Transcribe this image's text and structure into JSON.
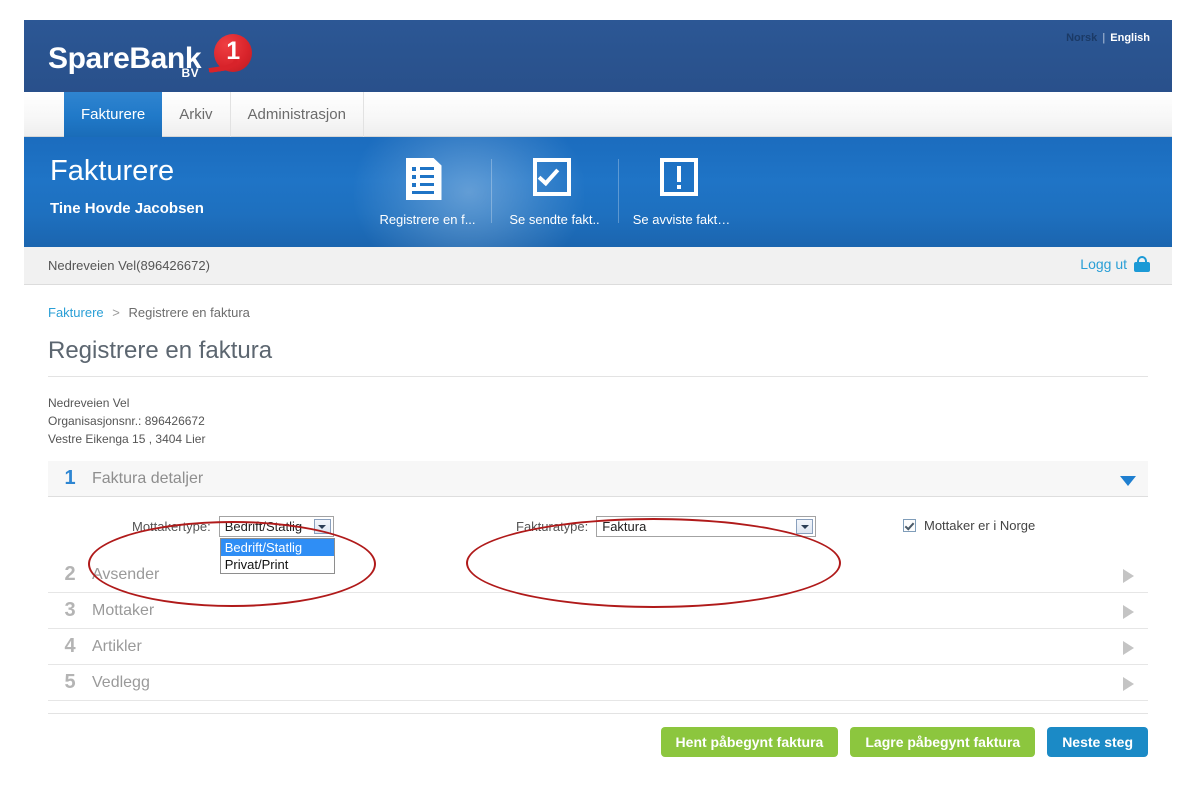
{
  "brand": {
    "name": "SpareBank",
    "sub": "BV",
    "mark_number": "1",
    "mark_color": "#d8232a",
    "band_color": "#2a5490"
  },
  "language": {
    "norsk": "Norsk",
    "separator": "|",
    "english": "English"
  },
  "tabs": [
    {
      "label": "Fakturere",
      "active": true
    },
    {
      "label": "Arkiv",
      "active": false
    },
    {
      "label": "Administrasjon",
      "active": false
    }
  ],
  "header": {
    "title": "Fakturere",
    "user": "Tine Hovde Jacobsen",
    "accent": "#1f74c6",
    "actions": [
      {
        "label": "Registrere en f...",
        "icon": "document-lines-icon"
      },
      {
        "label": "Se sendte fakt..",
        "icon": "checkbox-check-icon"
      },
      {
        "label": "Se avviste fakt…",
        "icon": "exclamation-box-icon"
      }
    ]
  },
  "orgbar": {
    "org": "Nedreveien Vel(896426672)",
    "logout": "Logg ut",
    "logout_icon": "padlock-icon",
    "link_color": "#2a9fd6"
  },
  "breadcrumb": {
    "parent": "Fakturere",
    "separator": ">",
    "current": "Registrere en faktura"
  },
  "page_title": "Registrere en faktura",
  "company": {
    "name": "Nedreveien Vel",
    "orgnr": "Organisasjonsnr.: 896426672",
    "address": "Vestre Eikenga 15 , 3404 Lier"
  },
  "steps": [
    {
      "num": "1",
      "label": "Faktura detaljer",
      "open": true,
      "icon": "chevron-down-icon"
    },
    {
      "num": "2",
      "label": "Avsender",
      "open": false,
      "icon": "chevron-right-icon"
    },
    {
      "num": "3",
      "label": "Mottaker",
      "open": false,
      "icon": "chevron-right-icon"
    },
    {
      "num": "4",
      "label": "Artikler",
      "open": false,
      "icon": "chevron-right-icon"
    },
    {
      "num": "5",
      "label": "Vedlegg",
      "open": false,
      "icon": "chevron-right-icon"
    }
  ],
  "form": {
    "mottakertype": {
      "label": "Mottakertype:",
      "value": "Bedrift/Statlig",
      "expanded": true,
      "options": [
        {
          "label": "Bedrift/Statlig",
          "selected": true
        },
        {
          "label": "Privat/Print",
          "selected": false
        }
      ]
    },
    "fakturatype": {
      "label": "Fakturatype:",
      "value": "Faktura",
      "expanded": false,
      "options": [
        {
          "label": "Faktura",
          "selected": true
        }
      ]
    },
    "mottaker_norge": {
      "label": "Mottaker er i Norge",
      "checked": true
    }
  },
  "buttons": [
    {
      "label": "Hent påbegynt faktura",
      "style": "green"
    },
    {
      "label": "Lagre påbegynt faktura",
      "style": "green"
    },
    {
      "label": "Neste steg",
      "style": "blue"
    }
  ],
  "annotations": {
    "color": "#b01a1a",
    "shapes": [
      {
        "name": "mottakertype-highlight"
      },
      {
        "name": "fakturatype-highlight"
      }
    ]
  }
}
